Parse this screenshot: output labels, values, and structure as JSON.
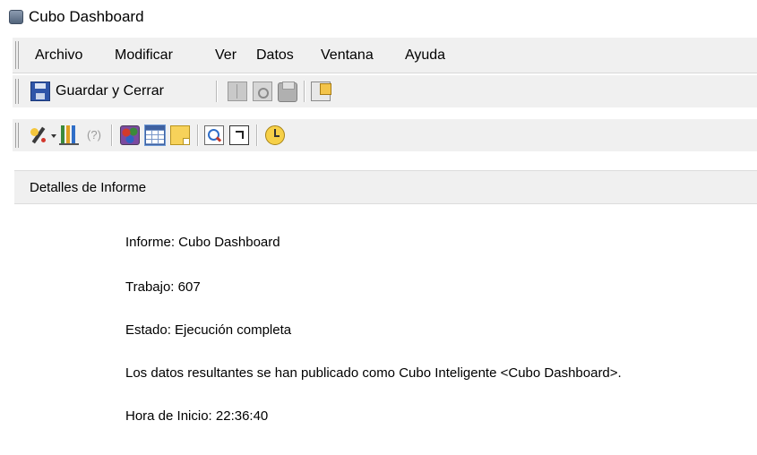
{
  "window": {
    "title": "Cubo Dashboard",
    "icon": "cube-icon"
  },
  "menubar": {
    "items": [
      {
        "label": "Archivo"
      },
      {
        "label": "Modificar"
      },
      {
        "label": "Ver"
      },
      {
        "label": "Datos"
      },
      {
        "label": "Ventana"
      },
      {
        "label": "Ayuda"
      }
    ]
  },
  "toolbar1": {
    "save_close_label": "Guardar y Cerrar",
    "icons": [
      "save-icon",
      "book-icon",
      "print-preview-icon",
      "print-icon",
      "properties-icon"
    ]
  },
  "toolbar2": {
    "help_glyph": "(?)",
    "icons": [
      "wizard-icon",
      "chart-icon",
      "help-icon",
      "graph-view-icon",
      "grid-view-icon",
      "note-icon",
      "find-icon",
      "launch-icon",
      "schedule-icon"
    ]
  },
  "details": {
    "title": "Detalles de Informe",
    "lines": [
      "Informe: Cubo Dashboard",
      "Trabajo: 607",
      "Estado: Ejecución completa",
      "Los datos resultantes se han publicado como Cubo Inteligente <Cubo Dashboard>.",
      "Hora de Inicio: 22:36:40"
    ]
  }
}
